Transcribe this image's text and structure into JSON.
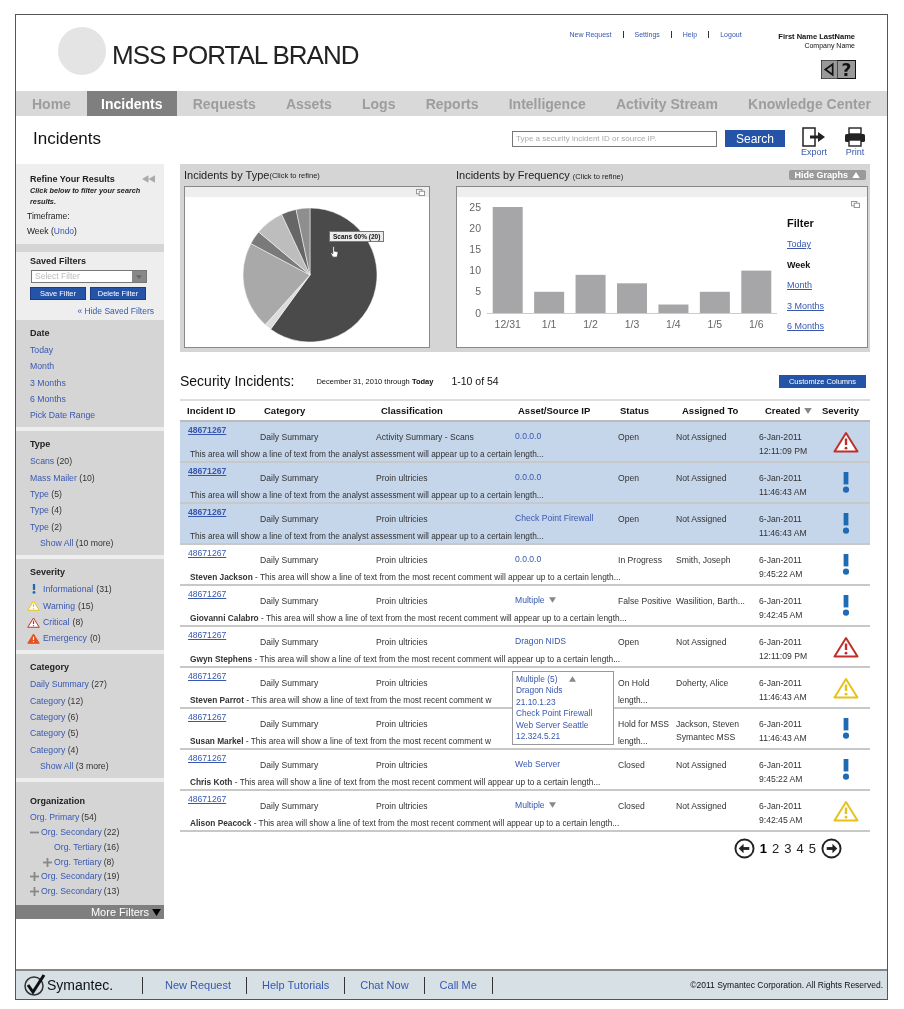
{
  "header": {
    "brand": "MSS PORTAL BRAND",
    "top_links": [
      "New Request",
      "Settings",
      "Help",
      "Logout"
    ],
    "user_name": "First Name LastName",
    "company": "Company Name",
    "help_glyph": "?"
  },
  "nav": [
    {
      "label": "Home",
      "selected": false
    },
    {
      "label": "Incidents",
      "selected": true
    },
    {
      "label": "Requests",
      "selected": false
    },
    {
      "label": "Assets",
      "selected": false
    },
    {
      "label": "Logs",
      "selected": false
    },
    {
      "label": "Reports",
      "selected": false
    },
    {
      "label": "Intelligence",
      "selected": false
    },
    {
      "label": "Activity Stream",
      "selected": false
    },
    {
      "label": "Knowledge Center",
      "selected": false
    }
  ],
  "page": {
    "title": "Incidents",
    "search": {
      "placeholder": "Type a security incident ID or source IP.",
      "button": "Search"
    },
    "export": "Export",
    "print": "Print"
  },
  "sidebar": {
    "refine": {
      "title": "Refine Your Results",
      "hint": "Click below to filter your search results.",
      "timeframe_label": "Timeframe:",
      "value_prefix": "Week (",
      "undo": "Undo",
      "value_suffix": ")"
    },
    "saved_filters": {
      "title": "Saved Filters",
      "placeholder": "Select Filter",
      "save": "Save Filter",
      "delete": "Delete Filter",
      "hide": "« Hide Saved Filters"
    },
    "date": {
      "title": "Date",
      "items": [
        "Today",
        "Month",
        "3 Months",
        "6 Months",
        "Pick Date Range"
      ]
    },
    "type": {
      "title": "Type",
      "items": [
        {
          "label": "Scans",
          "count": "(20)"
        },
        {
          "label": "Mass Mailer",
          "count": "(10)"
        },
        {
          "label": "Type",
          "count": "(5)"
        },
        {
          "label": "Type",
          "count": "(4)"
        },
        {
          "label": "Type",
          "count": "(2)"
        }
      ],
      "show_all": "Show All",
      "more": "(10 more)"
    },
    "severity": {
      "title": "Severity",
      "items": [
        {
          "kind": "informational",
          "label": "Informational",
          "count": "(31)"
        },
        {
          "kind": "warning",
          "label": "Warning",
          "count": "(15)"
        },
        {
          "kind": "critical",
          "label": "Critical",
          "count": "(8)"
        },
        {
          "kind": "emergency",
          "label": "Emergency",
          "count": "(0)"
        }
      ]
    },
    "category": {
      "title": "Category",
      "items": [
        {
          "label": "Daily Summary",
          "count": "(27)"
        },
        {
          "label": "Category",
          "count": "(12)"
        },
        {
          "label": "Category",
          "count": "(6)"
        },
        {
          "label": "Category",
          "count": "(5)"
        },
        {
          "label": "Category",
          "count": "(4)"
        }
      ],
      "show_all": "Show All",
      "more": "(3 more)"
    },
    "organization": {
      "title": "Organization",
      "items": [
        {
          "label": "Org. Primary",
          "count": "(54)",
          "children": [
            {
              "label": "Org. Secondary",
              "count": "(22)",
              "expanded": true,
              "children": [
                {
                  "label": "Org. Tertiary",
                  "count": "(16)"
                },
                {
                  "label": "Org. Tertiary",
                  "count": "(8)",
                  "expanded": false
                }
              ]
            },
            {
              "label": "Org. Secondary",
              "count": "(19)",
              "expanded": false
            },
            {
              "label": "Org. Secondary",
              "count": "(13)",
              "expanded": false
            }
          ]
        }
      ]
    },
    "more_filters": "More Filters"
  },
  "charts": {
    "hide_graphs": "Hide Graphs",
    "by_type": {
      "title": "Incidents by Type",
      "hint": "(Click to refine)",
      "tooltip": "Scans 60% (20)"
    },
    "by_frequency": {
      "title": "Incidents by Frequency",
      "hint": "(Click to refine)",
      "chart_data": {
        "type": "bar",
        "categories": [
          "12/31",
          "1/1",
          "1/2",
          "1/3",
          "1/4",
          "1/5",
          "1/6"
        ],
        "values": [
          25,
          5,
          9,
          7,
          2,
          5,
          10
        ],
        "ylim": [
          0,
          25
        ],
        "yticks": [
          0,
          5,
          10,
          15,
          20,
          25
        ]
      },
      "filter_title": "Filter",
      "filters": [
        {
          "label": "Today",
          "selected": false
        },
        {
          "label": "Week",
          "selected": true
        },
        {
          "label": "Month",
          "selected": false
        },
        {
          "label": "3 Months",
          "selected": false
        },
        {
          "label": "6 Months",
          "selected": false
        }
      ]
    }
  },
  "incidents": {
    "title": "Security Incidents:",
    "range_prefix": "December 31, 2010 through ",
    "range_end": "Today",
    "count": "1-10 of 54",
    "customize": "Customize Columns",
    "columns": [
      {
        "label": "Incident ID",
        "sorted": false
      },
      {
        "label": "Category",
        "sorted": false
      },
      {
        "label": "Classification",
        "sorted": false
      },
      {
        "label": "Asset/Source IP",
        "sorted": false
      },
      {
        "label": "Status",
        "sorted": false
      },
      {
        "label": "Assigned To",
        "sorted": false
      },
      {
        "label": "Created",
        "sorted": true
      },
      {
        "label": "Severity",
        "sorted": false
      }
    ],
    "rows": [
      {
        "selected": true,
        "id": "48671267",
        "category": "Daily Summary",
        "classification": "Activity Summary - Scans",
        "asset": {
          "kind": "link",
          "label": "0.0.0.0"
        },
        "status": "Open",
        "assigned": [
          "Not Assigned"
        ],
        "date": "6-Jan-2011",
        "time": "12:11:09 PM",
        "kind": "critical",
        "comment": "This area will show a line of text from the analyst assessment will appear up to a certain length..."
      },
      {
        "selected": true,
        "id": "48671267",
        "category": "Daily Summary",
        "classification": "Proin ultricies",
        "asset": {
          "kind": "link",
          "label": "0.0.0.0"
        },
        "status": "Open",
        "assigned": [
          "Not Assigned"
        ],
        "date": "6-Jan-2011",
        "time": "11:46:43 AM",
        "kind": "informational",
        "comment": "This area will show a line of text from the analyst assessment will appear up to a certain length..."
      },
      {
        "selected": true,
        "id": "48671267",
        "category": "Daily Summary",
        "classification": "Proin ultricies",
        "asset": {
          "kind": "link",
          "label": "Check Point Firewall"
        },
        "status": "Open",
        "assigned": [
          "Not Assigned"
        ],
        "date": "6-Jan-2011",
        "time": "11:46:43 AM",
        "kind": "informational",
        "comment": "This area will show a line of text from the analyst assessment will appear up to a certain length..."
      },
      {
        "selected": false,
        "id": "48671267",
        "category": "Daily Summary",
        "classification": "Proin ultricies",
        "asset": {
          "kind": "link",
          "label": "0.0.0.0"
        },
        "status": "In Progress",
        "assigned": [
          "Smith, Joseph"
        ],
        "date": "6-Jan-2011",
        "time": "9:45:22 AM",
        "kind": "informational",
        "comment": "**Steven Jackson** - This area will show a line of text from the most recent comment will appear up to a certain length..."
      },
      {
        "selected": false,
        "id": "48671267",
        "category": "Daily Summary",
        "classification": "Proin ultricies",
        "asset": {
          "kind": "multiple",
          "label": "Multiple",
          "expanded": false
        },
        "status": "False Positive",
        "assigned": [
          "Wasilition, Barth..."
        ],
        "date": "6-Jan-2011",
        "time": "9:42:45 AM",
        "kind": "informational",
        "comment": "**Giovanni Calabro** - This area will show a line of text from the most recent comment will appear up to a certain length..."
      },
      {
        "selected": false,
        "id": "48671267",
        "category": "Daily Summary",
        "classification": "Proin ultricies",
        "asset": {
          "kind": "link",
          "label": "Dragon NIDS"
        },
        "status": "Open",
        "assigned": [
          "Not Assigned"
        ],
        "date": "6-Jan-2011",
        "time": "12:11:09 PM",
        "kind": "critical",
        "comment": "**Gwyn Stephens** - This area will show a line of text from the most recent comment will appear up to a certain length..."
      },
      {
        "selected": false,
        "id": "48671267",
        "category": "Daily Summary",
        "classification": "Proin ultricies",
        "asset": {
          "kind": "multiple",
          "label": "Multiple (5)",
          "expanded": true,
          "items": [
            "Dragon Nids",
            "21.10.1.23",
            "Check Point Firewall",
            "Web Server Seattle",
            "12.324.5.21"
          ]
        },
        "status": "On Hold",
        "assigned": [
          "Doherty, Alice"
        ],
        "date": "6-Jan-2011",
        "time": "11:46:43 AM",
        "kind": "warning",
        "comment": "**Steven Parrot** - This area will show a line of text from the most recent comment w",
        "comment_tail": "length..."
      },
      {
        "selected": false,
        "id": "48671267",
        "category": "Daily Summary",
        "classification": "Proin ultricies",
        "status": "Hold for MSS",
        "assigned": [
          "Jackson, Steven",
          "Symantec MSS"
        ],
        "date": "6-Jan-2011",
        "time": "11:46:43 AM",
        "kind": "informational",
        "comment": "**Susan Markel** - This area will show a line of text from the most recent comment w",
        "comment_tail": "length..."
      },
      {
        "selected": false,
        "id": "48671267",
        "category": "Daily Summary",
        "classification": "Proin ultricies",
        "asset": {
          "kind": "link",
          "label": "Web Server"
        },
        "status": "Closed",
        "assigned": [
          "Not Assigned"
        ],
        "date": "6-Jan-2011",
        "time": "9:45:22 AM",
        "kind": "informational",
        "comment": "**Chris Koth** - This area will show a line of text from the most recent comment will appear up to a certain length..."
      },
      {
        "selected": false,
        "id": "48671267",
        "category": "Daily Summary",
        "classification": "Proin ultricies",
        "asset": {
          "kind": "multiple",
          "label": "Multiple",
          "expanded": false
        },
        "status": "Closed",
        "assigned": [
          "Not Assigned"
        ],
        "date": "6-Jan-2011",
        "time": "9:42:45 AM",
        "kind": "warning",
        "comment": "**Alison Peacock** - This area will show a line of text from the most recent comment will appear up to a certain length..."
      }
    ],
    "pages": [
      {
        "label": "1",
        "selected": true
      },
      {
        "label": "2",
        "selected": false
      },
      {
        "label": "3",
        "selected": false
      },
      {
        "label": "4",
        "selected": false
      },
      {
        "label": "5",
        "selected": false
      }
    ]
  },
  "footer": {
    "logo": "Symantec.",
    "links": [
      "New Request",
      "Help Tutorials",
      "Chat Now",
      "Call Me"
    ],
    "copyright": "©2011 Symantec Corporation. All Rights Reserved."
  }
}
